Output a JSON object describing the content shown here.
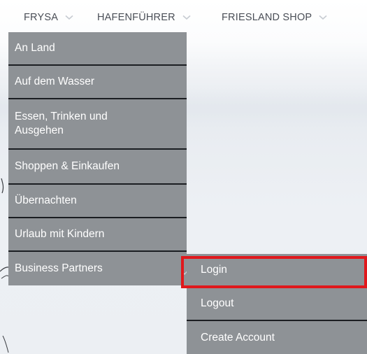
{
  "topnav": {
    "items": [
      {
        "label": "FRYSA",
        "icon": "chevron-down-icon"
      },
      {
        "label": "HAFENFÜHRER",
        "icon": "chevron-down-icon"
      },
      {
        "label": "FRIESLAND SHOP",
        "icon": "chevron-down-icon"
      }
    ]
  },
  "dropdown": {
    "items": [
      {
        "label": "An Land"
      },
      {
        "label": "Auf dem Wasser"
      },
      {
        "label": "Essen, Trinken und Ausgehen"
      },
      {
        "label": "Shoppen & Einkaufen"
      },
      {
        "label": "Übernachten"
      },
      {
        "label": "Urlaub mit Kindern"
      },
      {
        "label": "Business Partners",
        "icon": "chevron-right-icon"
      }
    ]
  },
  "submenu": {
    "items": [
      {
        "label": "Login"
      },
      {
        "label": "Logout"
      },
      {
        "label": "Create Account"
      }
    ]
  },
  "colors": {
    "menu_bg": "#8e9296",
    "menu_text": "#ffffff",
    "separator": "#1b1e22",
    "nav_text": "#4a4e56",
    "highlight": "#e0181c"
  }
}
